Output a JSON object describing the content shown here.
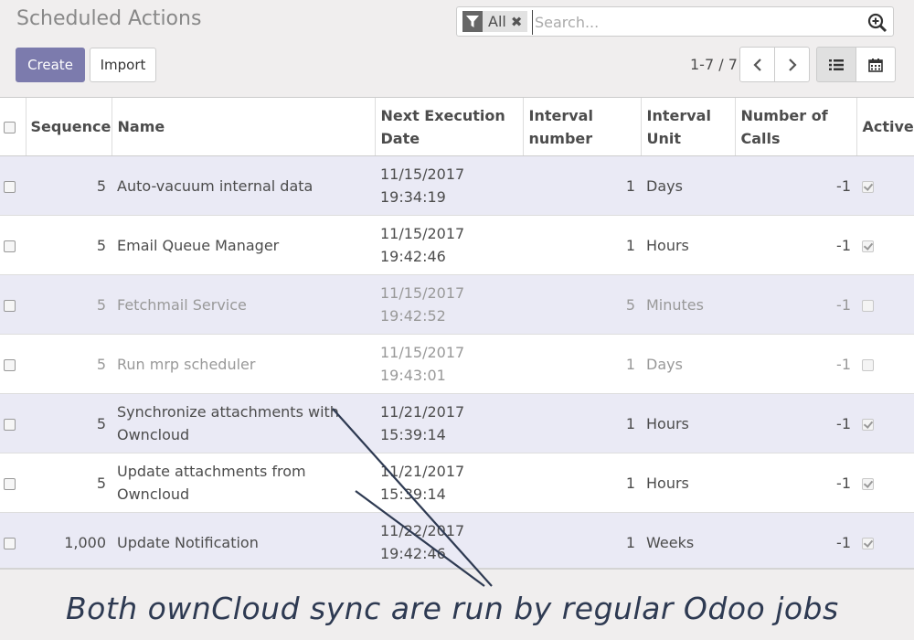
{
  "page": {
    "title": "Scheduled Actions"
  },
  "search": {
    "facet_label": "All",
    "placeholder": "Search..."
  },
  "buttons": {
    "create": "Create",
    "import": "Import"
  },
  "pager": {
    "value": "1-7 / 7"
  },
  "table": {
    "headers": {
      "sequence": "Sequence",
      "name": "Name",
      "next_exec_1": "Next Execution",
      "next_exec_2": "Date",
      "interval_number_1": "Interval",
      "interval_number_2": "number",
      "interval_unit_1": "Interval",
      "interval_unit_2": "Unit",
      "calls_1": "Number of",
      "calls_2": "Calls",
      "active": "Active"
    },
    "rows": [
      {
        "sequence": "5",
        "name": "Auto-vacuum internal data",
        "date": "11/15/2017",
        "time": "19:34:19",
        "interval": "1",
        "unit": "Days",
        "calls": "-1",
        "active": true
      },
      {
        "sequence": "5",
        "name": "Email Queue Manager",
        "date": "11/15/2017",
        "time": "19:42:46",
        "interval": "1",
        "unit": "Hours",
        "calls": "-1",
        "active": true
      },
      {
        "sequence": "5",
        "name": "Fetchmail Service",
        "date": "11/15/2017",
        "time": "19:42:52",
        "interval": "5",
        "unit": "Minutes",
        "calls": "-1",
        "active": false
      },
      {
        "sequence": "5",
        "name": "Run mrp scheduler",
        "date": "11/15/2017",
        "time": "19:43:01",
        "interval": "1",
        "unit": "Days",
        "calls": "-1",
        "active": false
      },
      {
        "sequence": "5",
        "name": "Synchronize attachments with Owncloud",
        "date": "11/21/2017",
        "time": "15:39:14",
        "interval": "1",
        "unit": "Hours",
        "calls": "-1",
        "active": true
      },
      {
        "sequence": "5",
        "name": "Update attachments from Owncloud",
        "date": "11/21/2017",
        "time": "15:39:14",
        "interval": "1",
        "unit": "Hours",
        "calls": "-1",
        "active": true
      },
      {
        "sequence": "1,000",
        "name": "Update Notification",
        "date": "11/22/2017",
        "time": "19:42:46",
        "interval": "1",
        "unit": "Weeks",
        "calls": "-1",
        "active": true
      }
    ]
  },
  "annotation": {
    "text": "Both ownCloud sync are run by regular Odoo jobs"
  },
  "colors": {
    "primary": "#7c7bad",
    "row_alt": "#eaeaf5",
    "annotation": "#2e3a52"
  }
}
